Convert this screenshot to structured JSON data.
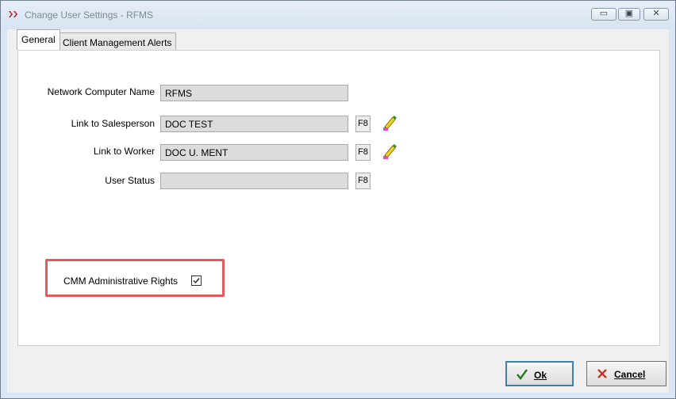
{
  "window": {
    "title": "Change User Settings - RFMS",
    "controls": {
      "minimize": "▭",
      "maximize": "▣",
      "close": "✕"
    }
  },
  "tabs": [
    {
      "label": "General",
      "active": true
    },
    {
      "label": "Client Management Alerts",
      "active": false
    }
  ],
  "form": {
    "network_computer_name": {
      "label": "Network Computer Name",
      "value": "RFMS"
    },
    "link_to_salesperson": {
      "label": "Link to Salesperson",
      "value": "DOC TEST",
      "lookup_key": "F8"
    },
    "link_to_worker": {
      "label": "Link to Worker",
      "value": "DOC U. MENT",
      "lookup_key": "F8"
    },
    "user_status": {
      "label": "User Status",
      "value": "",
      "lookup_key": "F8"
    },
    "cmm_admin_rights": {
      "label": "CMM Administrative Rights",
      "checked": true
    }
  },
  "buttons": {
    "ok": "Ok",
    "cancel": "Cancel"
  },
  "colors": {
    "highlight": "#e35b5b",
    "ok_icon": "#1f7a1f",
    "cancel_icon": "#c0392b"
  }
}
